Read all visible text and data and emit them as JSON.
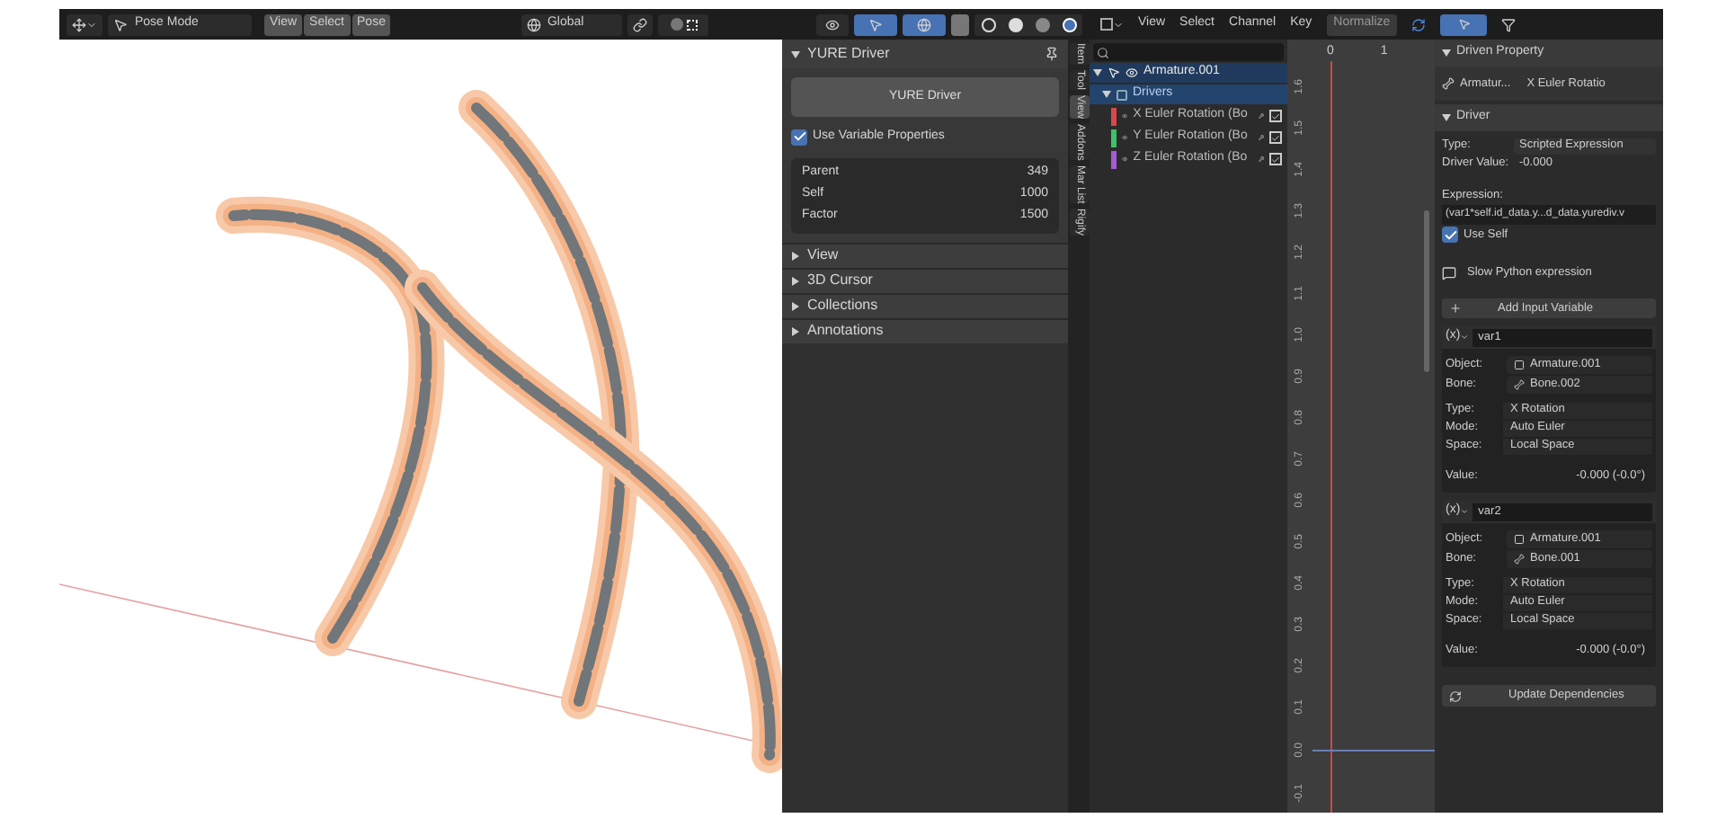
{
  "viewport": {
    "header": {
      "mode": "Pose Mode",
      "menus": [
        "View",
        "Select",
        "Pose"
      ],
      "orientation": "Global"
    },
    "panel": {
      "title": "YURE Driver",
      "button": "YURE Driver",
      "option": {
        "label": "Use Variable Properties",
        "checked": true
      },
      "properties": [
        {
          "label": "Parent",
          "value": "349"
        },
        {
          "label": "Self",
          "value": "1000"
        },
        {
          "label": "Factor",
          "value": "1500"
        }
      ],
      "sections": [
        {
          "label": "View",
          "expanded": false
        },
        {
          "label": "3D Cursor",
          "expanded": false
        },
        {
          "label": "Collections",
          "expanded": false
        },
        {
          "label": "Annotations",
          "expanded": false
        }
      ]
    },
    "tabs": [
      {
        "label": "Item",
        "selected": false
      },
      {
        "label": "Tool",
        "selected": false
      },
      {
        "label": "View",
        "selected": true
      },
      {
        "label": "Addons",
        "selected": false
      },
      {
        "label": "Mar List",
        "selected": false
      },
      {
        "label": "Rigify",
        "selected": false
      }
    ]
  },
  "graph_editor": {
    "menus": [
      "View",
      "Select",
      "Channel",
      "Key"
    ],
    "normalize": "Normalize",
    "channels": [
      {
        "label": "Armature.001",
        "expanded": true,
        "children": [
          {
            "label": "Drivers",
            "expanded": true,
            "children": [
              {
                "label": "X Euler Rotation (Bo",
                "color": "#d9474b",
                "checked": true
              },
              {
                "label": "Y Euler Rotation (Bo",
                "color": "#3fc06a",
                "checked": true
              },
              {
                "label": "Z Euler Rotation (Bo",
                "color": "#a55ad6",
                "checked": true
              }
            ]
          }
        ]
      }
    ],
    "x_labels": [
      "0",
      "1"
    ],
    "y_labels": [
      "1.6",
      "1.5",
      "1.4",
      "1.3",
      "1.2",
      "1.1",
      "1.0",
      "0.9",
      "0.8",
      "0.7",
      "0.6",
      "0.5",
      "0.4",
      "0.3",
      "0.2",
      "0.1",
      "0.0",
      "-0.1"
    ]
  },
  "driver_panel": {
    "driven_property": {
      "title": "Driven Property",
      "object": "Armatur...",
      "property": "X Euler Rotatio"
    },
    "driver": {
      "title": "Driver",
      "fields": [
        {
          "label": "Type:",
          "value": "Scripted Expression"
        },
        {
          "label": "Driver Value:",
          "value": "-0.000"
        }
      ],
      "expression_label": "Expression:",
      "expression": "(var1*self.id_data.y...d_data.yurediv.v",
      "use_self": {
        "label": "Use Self",
        "checked": true
      },
      "warning": "Slow Python expression",
      "add_variable": "Add Input Variable",
      "variables": [
        {
          "type_label": "(x)",
          "name": "var1",
          "target": [
            {
              "label": "Object:",
              "value": "Armature.001",
              "kind": "object"
            },
            {
              "label": "Bone:",
              "value": "Bone.002",
              "kind": "bone"
            }
          ],
          "settings": [
            {
              "label": "Type:",
              "value": "X Rotation"
            },
            {
              "label": "Mode:",
              "value": "Auto Euler"
            },
            {
              "label": "Space:",
              "value": "Local Space"
            }
          ],
          "value_label": "Value:",
          "value": "-0.000 (-0.0°)"
        },
        {
          "type_label": "(x)",
          "name": "var2",
          "target": [
            {
              "label": "Object:",
              "value": "Armature.001",
              "kind": "object"
            },
            {
              "label": "Bone:",
              "value": "Bone.001",
              "kind": "bone"
            }
          ],
          "settings": [
            {
              "label": "Type:",
              "value": "X Rotation"
            },
            {
              "label": "Mode:",
              "value": "Auto Euler"
            },
            {
              "label": "Space:",
              "value": "Local Space"
            }
          ],
          "value_label": "Value:",
          "value": "-0.000 (-0.0°)"
        }
      ],
      "update": "Update Dependencies"
    }
  }
}
